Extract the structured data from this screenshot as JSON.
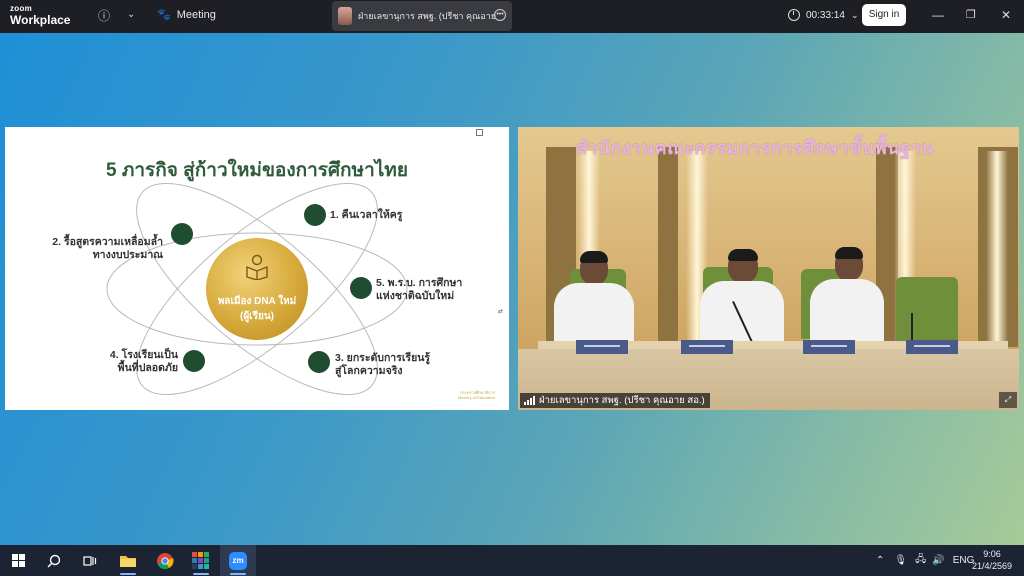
{
  "titlebar": {
    "logo_top": "zoom",
    "logo_bottom": "Workplace",
    "info_icon": "info-icon",
    "meeting_label": "Meeting",
    "active_speaker": "ฝ่ายเลขานุการ สพฐ. (ปรีชา  คุณอาย สอ.)",
    "timer": "00:33:14",
    "sign_in": "Sign in"
  },
  "slide": {
    "title": "5 ภารกิจ สู่ก้าวใหม่ของการศึกษาไทย",
    "center_line1": "พลเมือง DNA ใหม่",
    "center_line2": "(ผู้เรียน)",
    "missions": [
      {
        "text1": "1. คืนเวลาให้ครู",
        "text2": ""
      },
      {
        "text1": "2. รื้อสูตรความเหลื่อมล้ำ",
        "text2": "ทางงบประมาณ"
      },
      {
        "text1": "5. พ.ร.บ. การศึกษา",
        "text2": "แห่งชาติฉบับใหม่"
      },
      {
        "text1": "4. โรงเรียนเป็น",
        "text2": "พื้นที่ปลอดภัย"
      },
      {
        "text1": "3. ยกระดับการเรียนรู้",
        "text2": "สู่โลกความจริง"
      }
    ],
    "ministry_line1": "กระทรวงศึกษาธิการ",
    "ministry_line2": "Ministry of Education",
    "accent_color": "#1f4d2f",
    "gold_color": "#d6a93a"
  },
  "video": {
    "banner": "สำนักงานคณะกรรมการการศึกษาขั้นพื้นฐาน",
    "participant_label": "ฝ่ายเลขานุการ สพฐ. (ปรีชา  คุณอาย สอ.)"
  },
  "taskbar": {
    "lang": "ENG",
    "time": "9:06",
    "date": "21/4/2569"
  }
}
